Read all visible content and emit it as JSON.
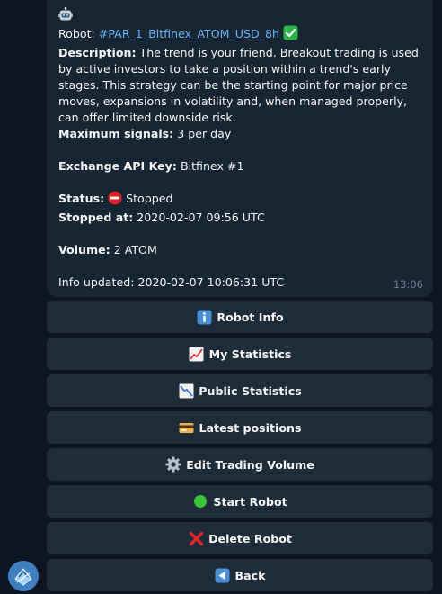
{
  "message": {
    "robot_label": "Robot: ",
    "robot_hashtag": "#PAR_1_Bitfinex_ATOM_USD_8h",
    "description_label": "Description:",
    "description_text": " The trend is your friend. Breakout trading is used by active investors to take a position within a trend's early stages. This strategy can be the starting point for major price moves, expansions in volatility and, when managed properly, can offer limited downside risk.",
    "max_signals_label": "Maximum signals:",
    "max_signals_value": " 3 per day",
    "api_key_label": "Exchange API Key:",
    "api_key_value": " Bitfinex #1",
    "status_label": "Status:",
    "status_value": " Stopped",
    "stopped_at_label": "Stopped at:",
    "stopped_at_value": " 2020-02-07 09:56 UTC",
    "volume_label": "Volume:",
    "volume_value": " 2 ATOM",
    "info_updated": "Info updated: 2020-02-07 10:06:31 UTC",
    "time": "13:06"
  },
  "buttons": [
    {
      "label": "Robot Info",
      "icon": "info-icon"
    },
    {
      "label": "My Statistics",
      "icon": "chart-up-icon"
    },
    {
      "label": "Public Statistics",
      "icon": "chart-down-icon"
    },
    {
      "label": "Latest positions",
      "icon": "credit-card-icon"
    },
    {
      "label": "Edit Trading Volume",
      "icon": "gear-icon"
    },
    {
      "label": "Start Robot",
      "icon": "green-circle-icon"
    },
    {
      "label": "Delete Robot",
      "icon": "cross-mark-icon"
    },
    {
      "label": "Back",
      "icon": "back-arrow-icon"
    }
  ],
  "colors": {
    "background": "#0e1621",
    "bubble": "#182533",
    "button": "#1f2c3a",
    "hashtag": "#6ab3f3",
    "check_green": "#2cb34a",
    "stop_red": "#d8232a",
    "start_green": "#3ac43a"
  }
}
